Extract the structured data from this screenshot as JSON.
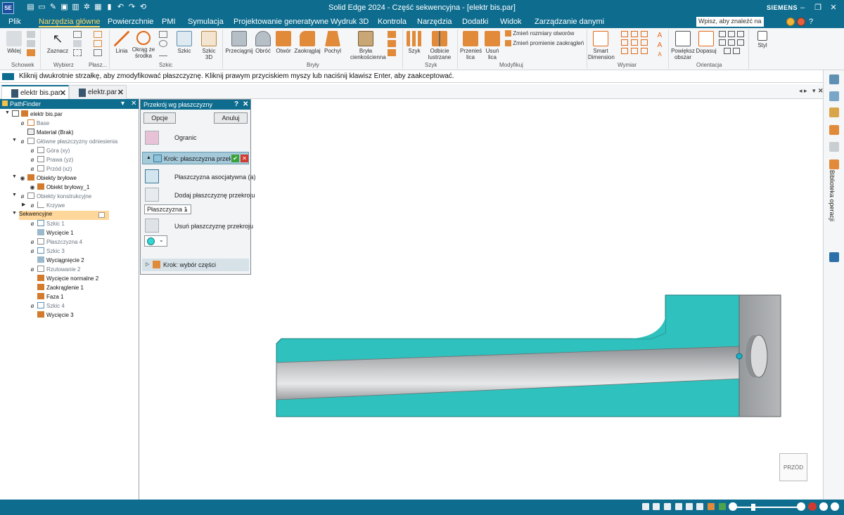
{
  "titlebar": {
    "app_badge": "SE",
    "title": "Solid Edge 2024 - Część sekwencyjna - [elektr bis.par]",
    "brand": "SIEMENS",
    "quick_access": [
      "new-file-icon",
      "open-icon",
      "brush-icon",
      "save-icon",
      "print-icon",
      "gear-icon",
      "layout-icon",
      "bookmark-icon",
      "undo-icon",
      "redo-icon",
      "refresh-icon"
    ]
  },
  "menubar": {
    "items": [
      "Plik",
      "Narzędzia główne",
      "Powierzchnie",
      "PMI",
      "Symulacja",
      "Projektowanie generatywne",
      "Wydruk 3D",
      "Kontrola",
      "Narzędzia",
      "Dodatki",
      "Widok",
      "Zarządzanie danymi"
    ],
    "active": "Narzędzia główne",
    "search_placeholder": "Wpisz, aby znaleźć na"
  },
  "ribbon": {
    "buttons": {
      "wklej": "Wklej",
      "zaznacz": "Zaznacz",
      "linia": "Linia",
      "okrag": "Okrąg ze środka",
      "szkic": "Szkic",
      "szkic3d": "Szkic 3D",
      "przeciagnij": "Przeciągnij",
      "obroc": "Obróć",
      "otwor": "Otwór",
      "zaokraglaj": "Zaokrąglaj",
      "pochyl": "Pochyl",
      "bryla": "Bryła cienkościenna",
      "szyk": "Szyk",
      "odbicie": "Odbicie lustrzane",
      "przenies": "Przenieś lica",
      "usun": "Usuń lica",
      "zmien_otwory": "Zmień rozmiary otworów",
      "zmien_promienie": "Zmień promienie zaokrągleń",
      "smart": "Smart Dimension",
      "powieksz": "Powiększ obszar",
      "dopasuj": "Dopasuj",
      "styl": "Styl"
    },
    "groups": [
      "Schowek",
      "Wybierz",
      "Płasz...",
      "Szkic",
      "Bryły",
      "Szyk",
      "Modyfikuj",
      "Wymiar",
      "Orientacja"
    ]
  },
  "hint": "Kliknij dwukrotnie strzałkę, aby zmodyfikować płaszczyznę. Kliknij prawym przyciskiem myszy lub naciśnij klawisz Enter, aby zaakceptować.",
  "tabs": [
    {
      "label": "elektr bis.par",
      "active": true
    },
    {
      "label": "elektr.par",
      "active": false
    }
  ],
  "pathfinder": {
    "title": "PathFinder",
    "rows": [
      {
        "label": "elektr bis.par"
      },
      {
        "label": "Base"
      },
      {
        "label": "Materiał (Brak)"
      },
      {
        "label": "Główne płaszczyzny odniesienia"
      },
      {
        "label": "Góra (xy)"
      },
      {
        "label": "Prawa (yz)"
      },
      {
        "label": "Przód (xz)"
      },
      {
        "label": "Obiekty bryłowe"
      },
      {
        "label": "Obiekt bryłowy_1"
      },
      {
        "label": "Obiekty konstrukcyjne"
      },
      {
        "label": "Krzywe"
      },
      {
        "label": "Sekwencyjne"
      },
      {
        "label": "Szkic 1"
      },
      {
        "label": "Wycięcie 1"
      },
      {
        "label": "Płaszczyzna 4"
      },
      {
        "label": "Szkic 3"
      },
      {
        "label": "Wyciągnięcie 2"
      },
      {
        "label": "Rzutowanie 2"
      },
      {
        "label": "Wycięcie normalne 2"
      },
      {
        "label": "Zaokrąglenie 1"
      },
      {
        "label": "Faza 1"
      },
      {
        "label": "Szkic 4"
      },
      {
        "label": "Wycięcie 3"
      }
    ]
  },
  "panel": {
    "title": "Przekrój wg płaszczyzny",
    "opcje": "Opcje",
    "anuluj": "Anuluj",
    "ogranic": "Ogranic",
    "step1": "Krok: płaszczyzna przekroju",
    "assoc": "Płaszczyzna asocjatywna (a)",
    "add": "Dodaj płaszczyznę przekroju",
    "plane_select": "Płaszczyzna 1",
    "remove": "Usuń płaszczyznę przekroju",
    "color": "#35d6d6",
    "step2": "Krok: wybór części"
  },
  "rightbar": {
    "vertical_label": "Biblioteka operacji"
  },
  "viewcube": {
    "label": "PRZÓD"
  },
  "colors": {
    "accent": "#0e6d8f",
    "cut_face": "#2fc1bd",
    "part_gray": "#a9acaf"
  }
}
